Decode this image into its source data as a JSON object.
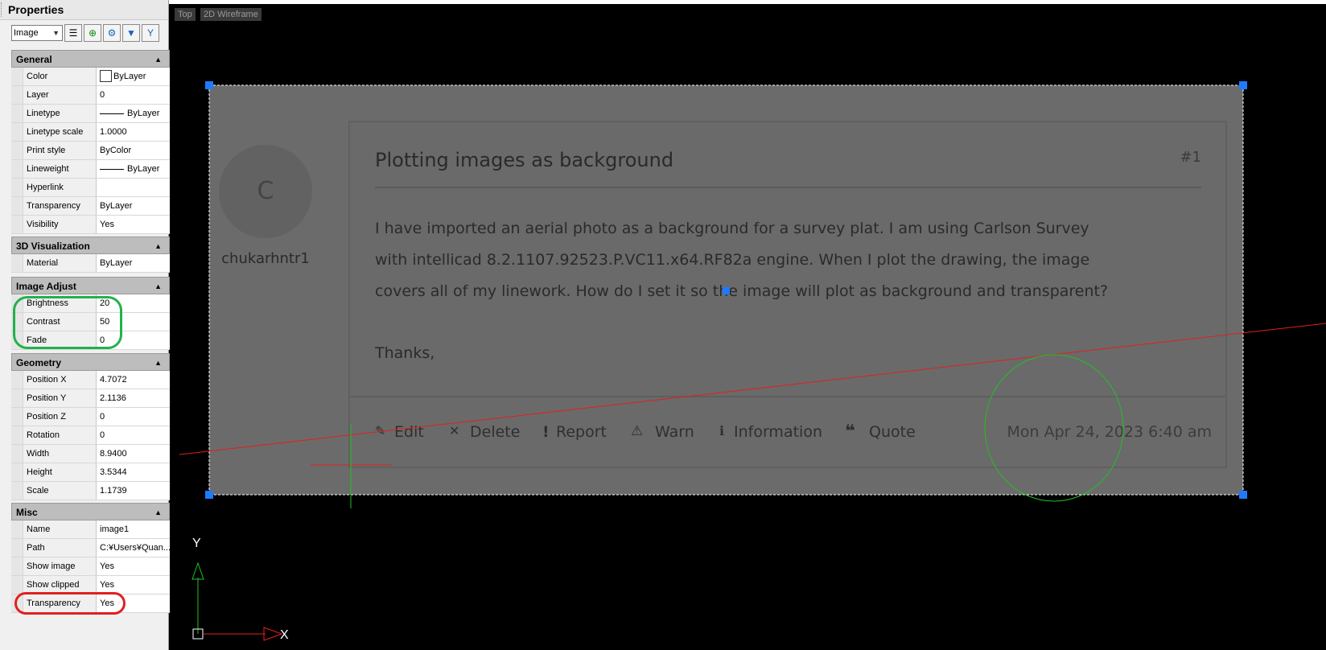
{
  "panel": {
    "title": "Properties",
    "object_type": "Image",
    "sections": {
      "general": {
        "title": "General",
        "rows": [
          {
            "name": "Color",
            "value": "ByLayer"
          },
          {
            "name": "Layer",
            "value": "0"
          },
          {
            "name": "Linetype",
            "value": "ByLayer"
          },
          {
            "name": "Linetype scale",
            "value": "1.0000"
          },
          {
            "name": "Print style",
            "value": "ByColor"
          },
          {
            "name": "Lineweight",
            "value": "ByLayer"
          },
          {
            "name": "Hyperlink",
            "value": ""
          },
          {
            "name": "Transparency",
            "value": "ByLayer"
          },
          {
            "name": "Visibility",
            "value": "Yes"
          }
        ]
      },
      "visualization": {
        "title": "3D Visualization",
        "rows": [
          {
            "name": "Material",
            "value": "ByLayer"
          }
        ]
      },
      "image_adjust": {
        "title": "Image Adjust",
        "rows": [
          {
            "name": "Brightness",
            "value": "20"
          },
          {
            "name": "Contrast",
            "value": "50"
          },
          {
            "name": "Fade",
            "value": "0"
          }
        ]
      },
      "geometry": {
        "title": "Geometry",
        "rows": [
          {
            "name": "Position X",
            "value": "4.7072"
          },
          {
            "name": "Position Y",
            "value": "2.1136"
          },
          {
            "name": "Position Z",
            "value": "0"
          },
          {
            "name": "Rotation",
            "value": "0"
          },
          {
            "name": "Width",
            "value": "8.9400"
          },
          {
            "name": "Height",
            "value": "3.5344"
          },
          {
            "name": "Scale",
            "value": "1.1739"
          }
        ]
      },
      "misc": {
        "title": "Misc",
        "rows": [
          {
            "name": "Name",
            "value": "image1"
          },
          {
            "name": "Path",
            "value": "C:¥Users¥Quan..."
          },
          {
            "name": "Show image",
            "value": "Yes"
          },
          {
            "name": "Show clipped",
            "value": "Yes"
          },
          {
            "name": "Transparency",
            "value": "Yes"
          }
        ]
      }
    },
    "icons": [
      "tree-icon",
      "add-selection-icon",
      "quick-select-icon",
      "filter-icon",
      "toggle-filter-icon"
    ]
  },
  "viewport": {
    "view_label": "Top",
    "style_label": "2D Wireframe",
    "axis_x": "X",
    "axis_y": "Y"
  },
  "image": {
    "avatar_letter": "C",
    "username": "chukarhntr1",
    "post_title": "Plotting images as background",
    "post_number": "#1",
    "body_lines": [
      "I have imported an aerial photo as a background for a survey plat. I am using Carlson Survey",
      "with intellicad 8.2.1107.92523.P.VC11.x64.RF82a engine. When I plot the drawing, the image",
      "covers all of my linework. How do I set it so the image will plot as background and transparent?"
    ],
    "thanks": "Thanks,",
    "actions": {
      "edit": "Edit",
      "delete": "Delete",
      "report": "Report",
      "warn": "Warn",
      "information": "Information",
      "quote": "Quote"
    },
    "timestamp": "Mon Apr 24, 2023 6:40 am"
  },
  "colors": {
    "highlight_green": "#22b14c",
    "highlight_red": "#e02020",
    "grip_blue": "#1e7bff",
    "image_gray": "#6b6b6b"
  }
}
